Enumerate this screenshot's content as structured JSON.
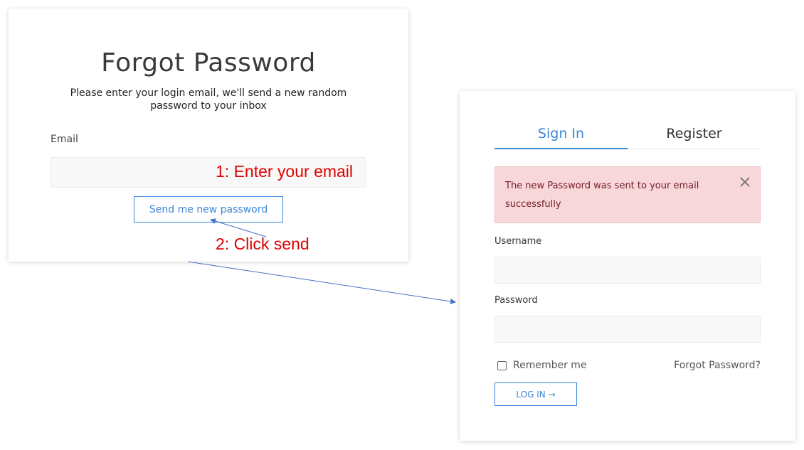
{
  "forgot_card": {
    "title": "Forgot Password",
    "subtitle": "Please enter your login email, we'll send a new random password to your inbox",
    "email_label": "Email",
    "email_value": "",
    "send_button": "Send me new password"
  },
  "annotations": {
    "step1": "1: Enter your email",
    "step2": "2: Click send"
  },
  "signin_card": {
    "tabs": [
      {
        "label": "Sign In",
        "active": true
      },
      {
        "label": "Register",
        "active": false
      }
    ],
    "alert": {
      "message": "The new Password was sent to your email successfully",
      "close_icon": "close-icon"
    },
    "username_label": "Username",
    "username_value": "",
    "password_label": "Password",
    "password_value": "",
    "remember_label": "Remember me",
    "remember_checked": false,
    "forgot_link": "Forgot Password?",
    "login_button": "LOG IN →"
  },
  "colors": {
    "accent": "#3d86d8",
    "annotation": "#e00000",
    "alert_bg": "#f8d7da",
    "alert_text": "#721c24",
    "arrow": "#4472c4"
  }
}
